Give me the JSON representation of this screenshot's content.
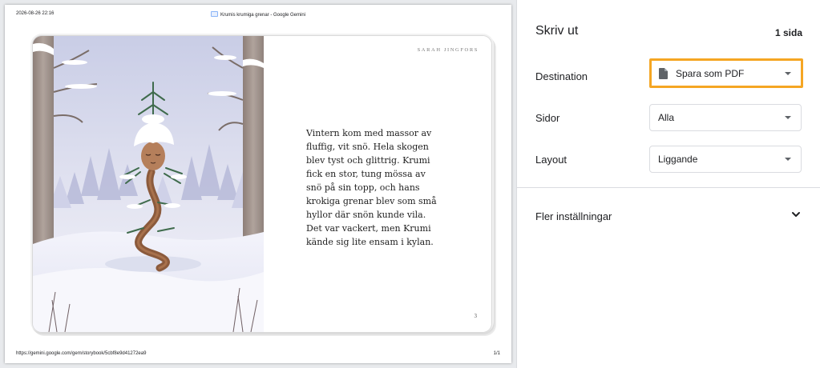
{
  "print_preview": {
    "header": {
      "datetime": "2026-08-26 22:16",
      "tab_title": "Krumis krumiga grenar - Google Gemini"
    },
    "footer": {
      "url": "https://gemini.google.com/gem/storybook/5cbf8e9d41272ea9",
      "page_indicator": "1/1"
    },
    "book": {
      "author": "SARAH JINGFORS",
      "text": "Vintern kom med massor av fluffig, vit snö. Hela skogen blev tyst och glittrig. Krumi fick en stor, tung mössa av snö på sin topp, och hans krokiga grenar blev som små hyllor där snön kunde vila. Det var vackert, men Krumi kände sig lite ensam i kylan.",
      "page_number": "3"
    }
  },
  "settings": {
    "title": "Skriv ut",
    "page_count": "1 sida",
    "destination": {
      "label": "Destination",
      "value": "Spara som PDF",
      "icon": "document-icon"
    },
    "pages": {
      "label": "Sidor",
      "value": "Alla"
    },
    "layout": {
      "label": "Layout",
      "value": "Liggande"
    },
    "more_settings": {
      "label": "Fler inställningar",
      "icon": "chevron-down-icon"
    },
    "focus_color": "#f5a623"
  }
}
